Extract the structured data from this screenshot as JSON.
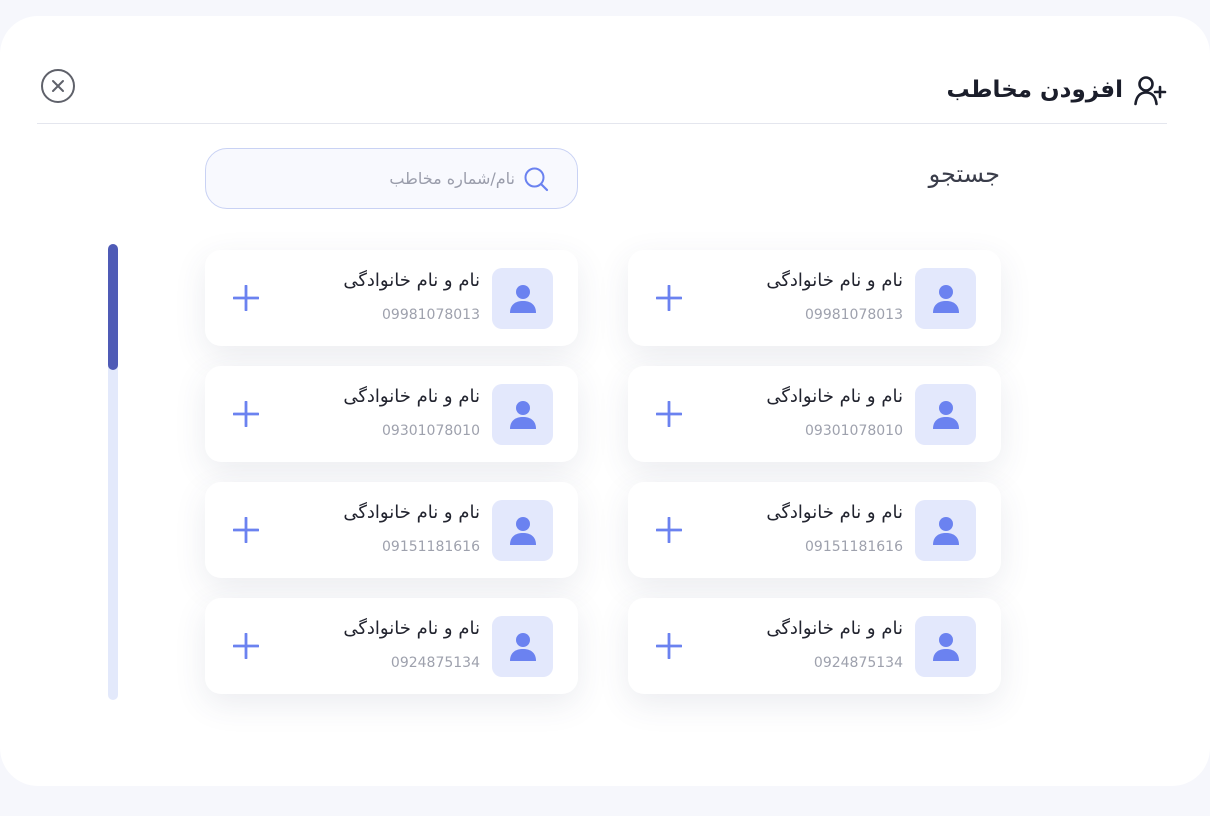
{
  "header": {
    "title": "افزودن مخاطب",
    "title_icon": "user-add-icon",
    "close_icon": "close-circle-icon"
  },
  "search": {
    "label": "جستجو",
    "placeholder": "نام/شماره مخاطب",
    "value": "",
    "icon": "search-icon"
  },
  "contacts": [
    {
      "name": "نام و نام خانوادگی",
      "phone": "09981078013"
    },
    {
      "name": "نام و نام خانوادگی",
      "phone": "09981078013"
    },
    {
      "name": "نام و نام خانوادگی",
      "phone": "09301078010"
    },
    {
      "name": "نام و نام خانوادگی",
      "phone": "09301078010"
    },
    {
      "name": "نام و نام خانوادگی",
      "phone": "09151181616"
    },
    {
      "name": "نام و نام خانوادگی",
      "phone": "09151181616"
    },
    {
      "name": "نام و نام خانوادگی",
      "phone": "0924875134"
    },
    {
      "name": "نام و نام خانوادگی",
      "phone": "0924875134"
    }
  ],
  "icons": {
    "avatar": "user-avatar-icon",
    "add": "plus-icon"
  },
  "colors": {
    "accent": "#6b82f0",
    "scroll_thumb": "#4f5bb6",
    "scroll_track": "#e3e9fb",
    "avatar_bg": "#e3e8fc"
  }
}
